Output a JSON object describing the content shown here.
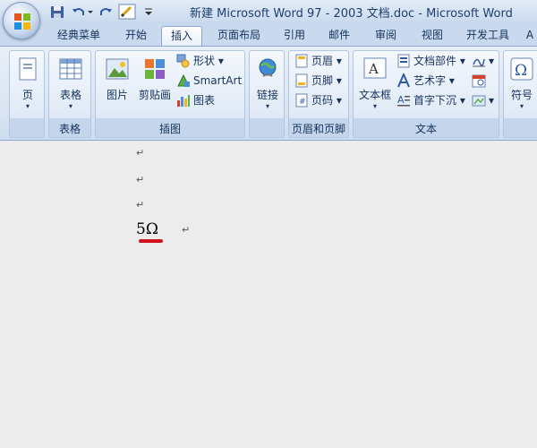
{
  "window": {
    "title": "新建 Microsoft Word 97 - 2003 文档.doc - Microsoft Word"
  },
  "tabs": [
    {
      "label": "经典菜单"
    },
    {
      "label": "开始"
    },
    {
      "label": "插入",
      "active": true
    },
    {
      "label": "页面布局"
    },
    {
      "label": "引用"
    },
    {
      "label": "邮件"
    },
    {
      "label": "审阅"
    },
    {
      "label": "视图"
    },
    {
      "label": "开发工具"
    },
    {
      "label": "A"
    }
  ],
  "ribbon": {
    "pages": {
      "page_label": "页",
      "dropdown": "▾"
    },
    "table": {
      "table_label": "表格",
      "group_label": "表格",
      "dropdown": "▾"
    },
    "illustrations": {
      "group_label": "插图",
      "picture_label": "图片",
      "clipart_label": "剪贴画",
      "shapes_label": "形状",
      "shapes_dropdown": "▾",
      "smartart_label": "SmartArt",
      "chart_label": "图表"
    },
    "links": {
      "link_label": "链接",
      "dropdown": "▾"
    },
    "header_footer": {
      "group_label": "页眉和页脚",
      "header_label": "页眉",
      "footer_label": "页脚",
      "page_number_label": "页码",
      "dropdown": "▾"
    },
    "text": {
      "group_label": "文本",
      "textbox_label": "文本框",
      "textbox_dropdown": "▾",
      "quickparts_label": "文档部件",
      "wordart_label": "艺术字",
      "dropcap_label": "首字下沉",
      "dropdown": "▾"
    },
    "symbols": {
      "symbol_label": "符号",
      "dropdown": "▾"
    }
  },
  "document": {
    "paragraph_mark": "↵",
    "text": "5Ω"
  },
  "colors": {
    "accent": "#15325c",
    "ribbon": "#dfe9f6",
    "document_bg": "#ececec",
    "underline": "#d0121b"
  }
}
